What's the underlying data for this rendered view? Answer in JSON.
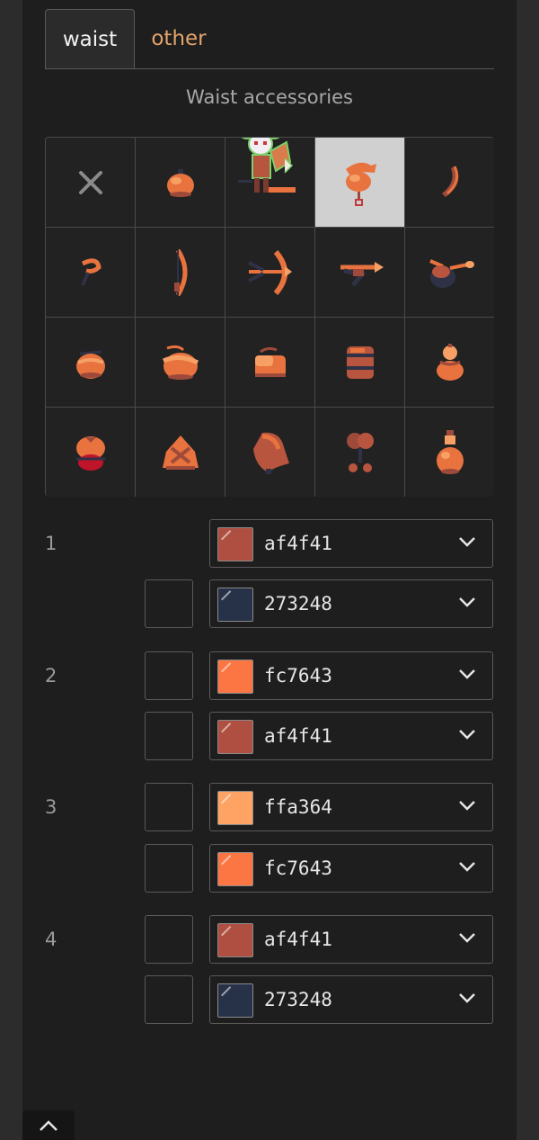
{
  "tabs": [
    {
      "label": "waist",
      "active": true
    },
    {
      "label": "other",
      "active": false
    }
  ],
  "section_title": "Waist accessories",
  "grid": {
    "selected_index": 3,
    "items": [
      {
        "icon": "close-icon"
      },
      {
        "icon": "pouch-icon"
      },
      {
        "icon": "character-preview-icon"
      },
      {
        "icon": "pendant-icon"
      },
      {
        "icon": "horn-icon"
      },
      {
        "icon": "hook-icon"
      },
      {
        "icon": "bow-icon"
      },
      {
        "icon": "crossbow-icon"
      },
      {
        "icon": "arrow-quiver-icon"
      },
      {
        "icon": "bird-quiver-icon"
      },
      {
        "icon": "round-pouch-icon"
      },
      {
        "icon": "flap-pouch-icon"
      },
      {
        "icon": "bag-icon"
      },
      {
        "icon": "barrel-pouch-icon"
      },
      {
        "icon": "gourd-icon"
      },
      {
        "icon": "red-pouch-icon"
      },
      {
        "icon": "bundle-icon"
      },
      {
        "icon": "cape-icon"
      },
      {
        "icon": "drumstick-icon"
      },
      {
        "icon": "bottle-icon"
      }
    ]
  },
  "colors": {
    "panel": "#1e1e1e",
    "accent_tab": "#e3a46c",
    "selected_cell": "#d0d0d0"
  },
  "color_groups": [
    {
      "number": "1",
      "rows": [
        {
          "hex": "af4f41",
          "color": "#af4f41",
          "checkbox": false
        },
        {
          "hex": "273248",
          "color": "#273248",
          "checkbox": true
        }
      ]
    },
    {
      "number": "2",
      "rows": [
        {
          "hex": "fc7643",
          "color": "#fc7643",
          "checkbox": true
        },
        {
          "hex": "af4f41",
          "color": "#af4f41",
          "checkbox": true
        }
      ]
    },
    {
      "number": "3",
      "rows": [
        {
          "hex": "ffa364",
          "color": "#ffa364",
          "checkbox": true
        },
        {
          "hex": "fc7643",
          "color": "#fc7643",
          "checkbox": true
        }
      ]
    },
    {
      "number": "4",
      "rows": [
        {
          "hex": "af4f41",
          "color": "#af4f41",
          "checkbox": true
        },
        {
          "hex": "273248",
          "color": "#273248",
          "checkbox": true
        }
      ]
    }
  ]
}
